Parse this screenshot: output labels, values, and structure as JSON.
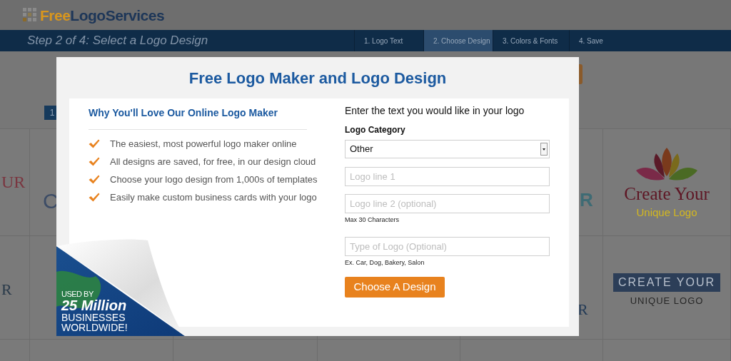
{
  "header": {
    "logo_part_1": "Free",
    "logo_part_2": "LogoServices"
  },
  "step_bar": {
    "title": "Step 2 of 4: Select a Logo Design",
    "steps": [
      {
        "label": "1. Logo Text",
        "selected": false
      },
      {
        "label": "2. Choose Design",
        "selected": true
      },
      {
        "label": "3. Colors & Fonts",
        "selected": false
      },
      {
        "label": "4. Save",
        "selected": false
      }
    ]
  },
  "background": {
    "page_number": "1",
    "cards": [
      {
        "kind": "red-fragment",
        "text": "UR"
      },
      {
        "kind": "navy-fragment",
        "text": "C"
      },
      {
        "kind": "teal-fragment",
        "text": "R"
      },
      {
        "kind": "lotus",
        "title": "Create Your",
        "subtitle": "Unique Logo"
      },
      {
        "kind": "dark-fragment",
        "text": "R"
      },
      {
        "kind": "navy-fragment-2",
        "text": "R"
      },
      {
        "kind": "ribbon",
        "title": "CREATE YOUR",
        "subtitle": "UNIQUE LOGO"
      }
    ]
  },
  "modal": {
    "title": "Free Logo Maker and Logo Design",
    "benefits_heading": "Why You'll Love Our Online Logo Maker",
    "benefits": [
      "The easiest, most powerful logo maker online",
      "All designs are saved, for free, in our design cloud",
      "Choose your logo design from 1,000s of templates",
      "Easily make custom business cards with your logo"
    ],
    "form_intro": "Enter the text you would like in your logo",
    "category_label": "Logo Category",
    "category_value": "Other",
    "fields": [
      {
        "placeholder": "Logo line 1"
      },
      {
        "placeholder": "Logo line 2 (optional)",
        "hint": "Max 30 Characters"
      },
      {
        "placeholder": "Type of Logo (Optional)",
        "hint": "Ex. Car, Dog, Bakery, Salon"
      }
    ],
    "submit": "Choose A Design",
    "badge": {
      "line_1": "USED BY",
      "line_2": "25 Million",
      "line_3": "BUSINESSES",
      "line_4": "WORLDWIDE!"
    }
  }
}
